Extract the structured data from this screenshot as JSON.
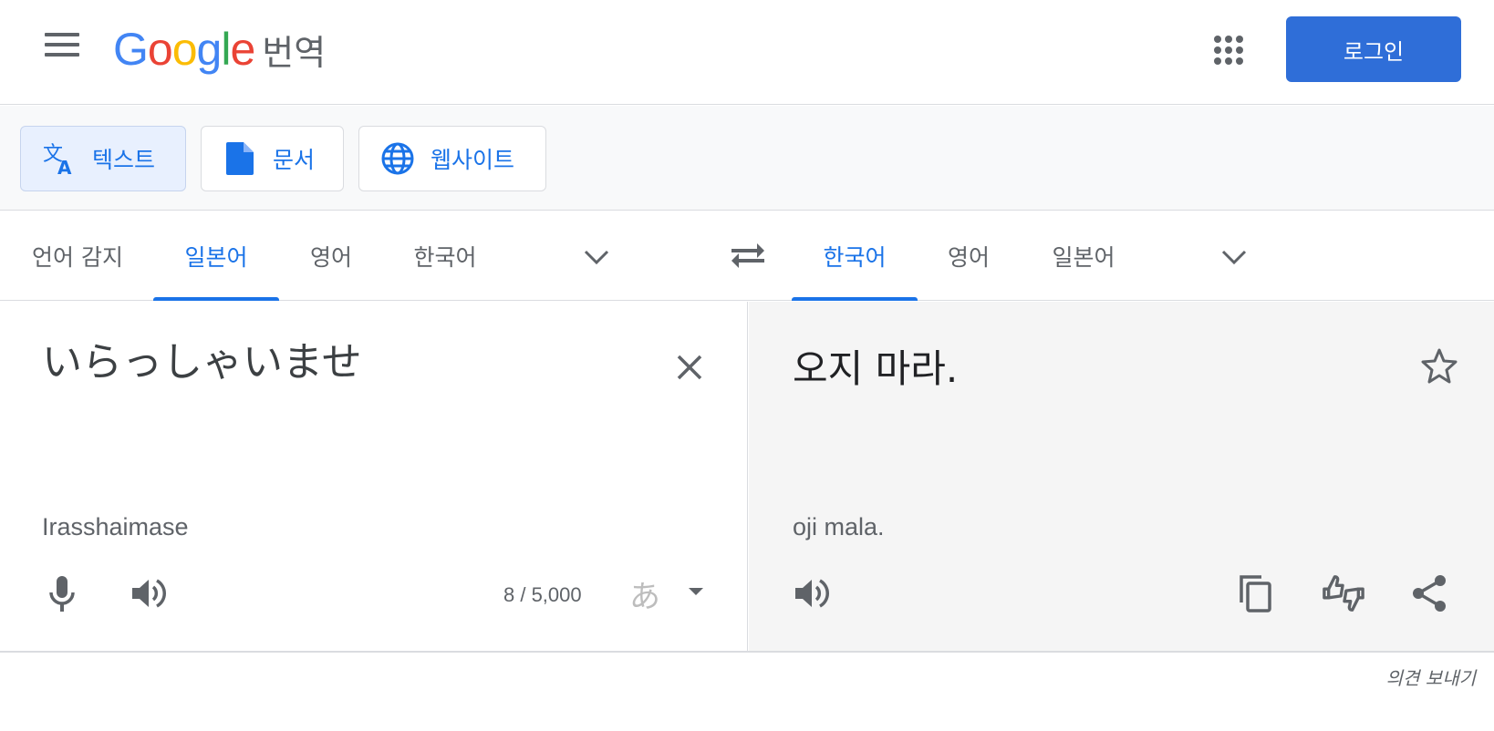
{
  "header": {
    "logo_letters": [
      "G",
      "o",
      "o",
      "g",
      "l",
      "e"
    ],
    "logo_colors": [
      "#4285f4",
      "#ea4335",
      "#fbbc05",
      "#4285f4",
      "#34a853",
      "#ea4335"
    ],
    "product_name": "번역",
    "login_label": "로그인",
    "icons": [
      "menu-icon",
      "apps-grid-icon"
    ]
  },
  "modes": {
    "text_label": "텍스트",
    "document_label": "문서",
    "website_label": "웹사이트",
    "active": "text"
  },
  "source_languages": {
    "tabs": [
      "언어 감지",
      "일본어",
      "영어",
      "한국어"
    ],
    "active_index": 1
  },
  "target_languages": {
    "tabs": [
      "한국어",
      "영어",
      "일본어"
    ],
    "active_index": 0
  },
  "source": {
    "text": "いらっしゃいませ",
    "romanization": "Irasshaimase",
    "char_count": "8 / 5,000",
    "ime_label": "あ"
  },
  "target": {
    "text": "오지 마라.",
    "romanization": "oji mala."
  },
  "footer": {
    "feedback_label": "의견 보내기"
  },
  "colors": {
    "accent": "#1a73e8",
    "login_button": "#2f6ed8",
    "target_panel_bg": "#f5f5f5"
  }
}
